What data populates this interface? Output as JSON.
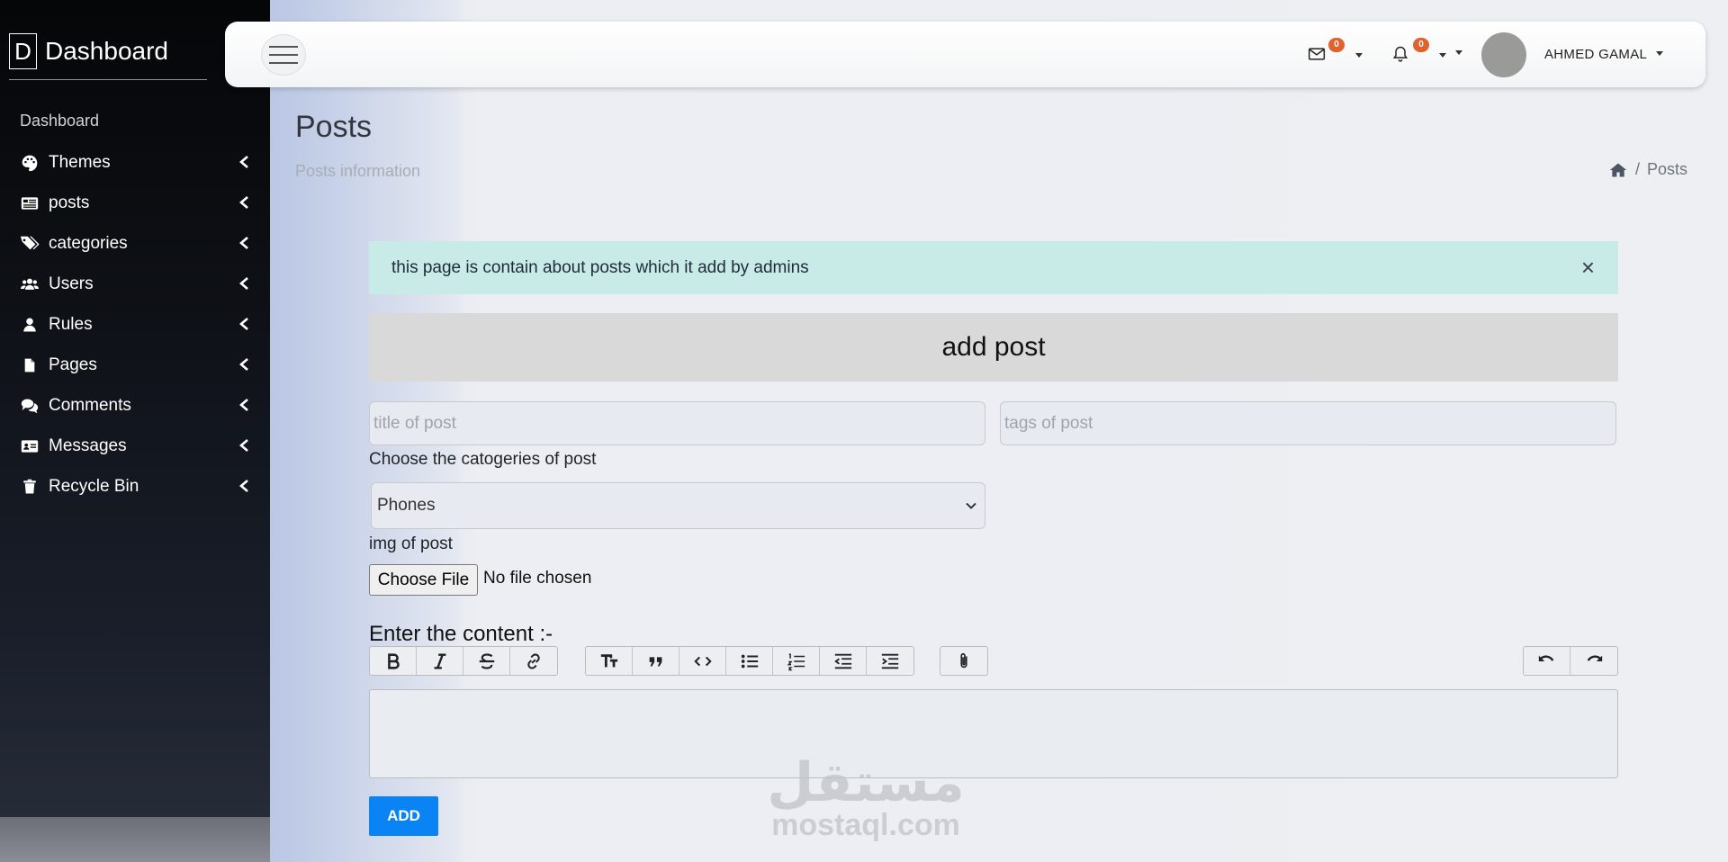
{
  "brand": {
    "logo_letter": "D",
    "title": "Dashboard"
  },
  "sidebar": {
    "heading": "Dashboard",
    "items": [
      {
        "label": "Themes",
        "icon": "palette-icon"
      },
      {
        "label": "posts",
        "icon": "newspaper-icon"
      },
      {
        "label": "categories",
        "icon": "tags-icon"
      },
      {
        "label": "Users",
        "icon": "users-icon"
      },
      {
        "label": "Rules",
        "icon": "user-icon"
      },
      {
        "label": "Pages",
        "icon": "file-icon"
      },
      {
        "label": "Comments",
        "icon": "comments-icon"
      },
      {
        "label": "Messages",
        "icon": "id-card-icon"
      },
      {
        "label": "Recycle Bin",
        "icon": "trash-icon"
      }
    ]
  },
  "topbar": {
    "messages_count": "0",
    "notifications_count": "0",
    "user_name": "AHMED GAMAL"
  },
  "page": {
    "title": "Posts",
    "subtitle": "Posts information",
    "breadcrumb_current": "Posts"
  },
  "alert": {
    "text": "this page is contain about posts which it add by admins",
    "close": "×"
  },
  "form": {
    "header": "add post",
    "title_placeholder": "title of post",
    "tags_placeholder": "tags of post",
    "category_label": "Choose the catogeries of post",
    "category_selected": "Phones",
    "image_label": "img of post",
    "file_button": "Choose File",
    "file_status": "No file chosen",
    "content_label": "Enter the content :-",
    "submit": "ADD"
  },
  "watermark": {
    "arabic": "مستقل",
    "latin": "mostaql.com"
  },
  "colors": {
    "accent": "#0a83f5",
    "badge": "#e0632e",
    "alert_bg": "#c9ebe7"
  }
}
